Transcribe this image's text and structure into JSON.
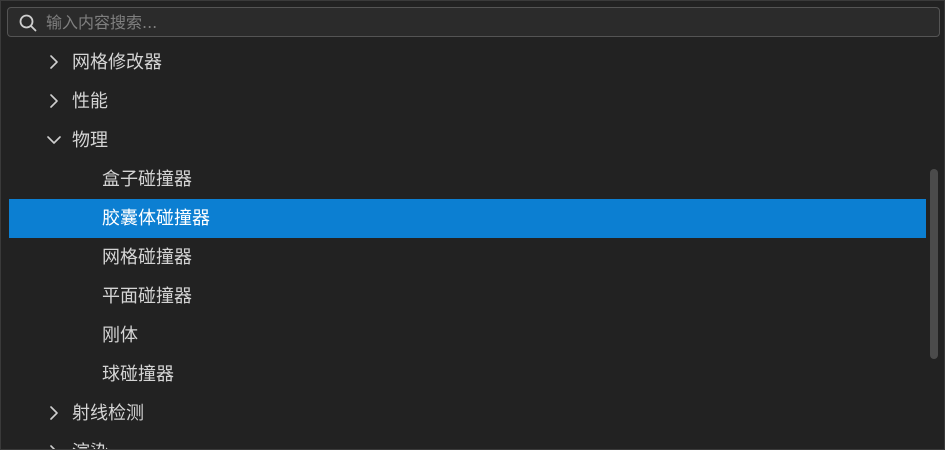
{
  "search": {
    "placeholder": "输入内容搜索...",
    "value": ""
  },
  "tree": {
    "items": [
      {
        "label": "网格修改器",
        "level": 0,
        "state": "collapsed",
        "selected": false
      },
      {
        "label": "性能",
        "level": 0,
        "state": "collapsed",
        "selected": false
      },
      {
        "label": "物理",
        "level": 0,
        "state": "expanded",
        "selected": false
      },
      {
        "label": "盒子碰撞器",
        "level": 1,
        "state": "leaf",
        "selected": false
      },
      {
        "label": "胶囊体碰撞器",
        "level": 1,
        "state": "leaf",
        "selected": true
      },
      {
        "label": "网格碰撞器",
        "level": 1,
        "state": "leaf",
        "selected": false
      },
      {
        "label": "平面碰撞器",
        "level": 1,
        "state": "leaf",
        "selected": false
      },
      {
        "label": "刚体",
        "level": 1,
        "state": "leaf",
        "selected": false
      },
      {
        "label": "球碰撞器",
        "level": 1,
        "state": "leaf",
        "selected": false
      },
      {
        "label": "射线检测",
        "level": 0,
        "state": "collapsed",
        "selected": false
      },
      {
        "label": "渲染",
        "level": 0,
        "state": "collapsed",
        "selected": false
      }
    ]
  },
  "colors": {
    "background": "#222222",
    "selection": "#0c7fd2",
    "text": "#d4d4d4",
    "placeholder": "#7f7f7f"
  }
}
